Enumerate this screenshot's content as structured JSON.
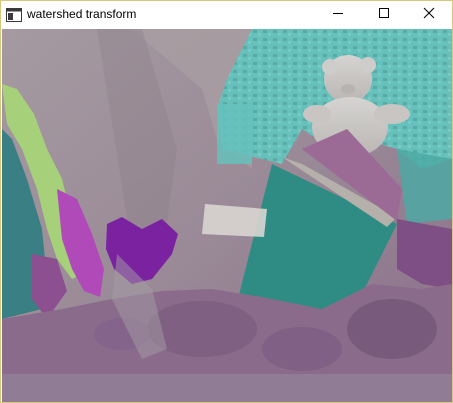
{
  "window": {
    "title": "watershed transform",
    "icon": "opencv-window-icon",
    "controls": {
      "minimize_icon": "minimize-icon",
      "maximize_icon": "maximize-icon",
      "close_icon": "close-icon"
    },
    "border_color": "#d6c77a"
  },
  "image": {
    "description_colors": {
      "background_violet": "#8f748d",
      "teal": "#5fb8b4",
      "dark_teal": "#2f8c84",
      "green": "#a6d07a",
      "magenta": "#b04ab8",
      "purple": "#7a22a0",
      "gray": "#9c9496"
    }
  }
}
